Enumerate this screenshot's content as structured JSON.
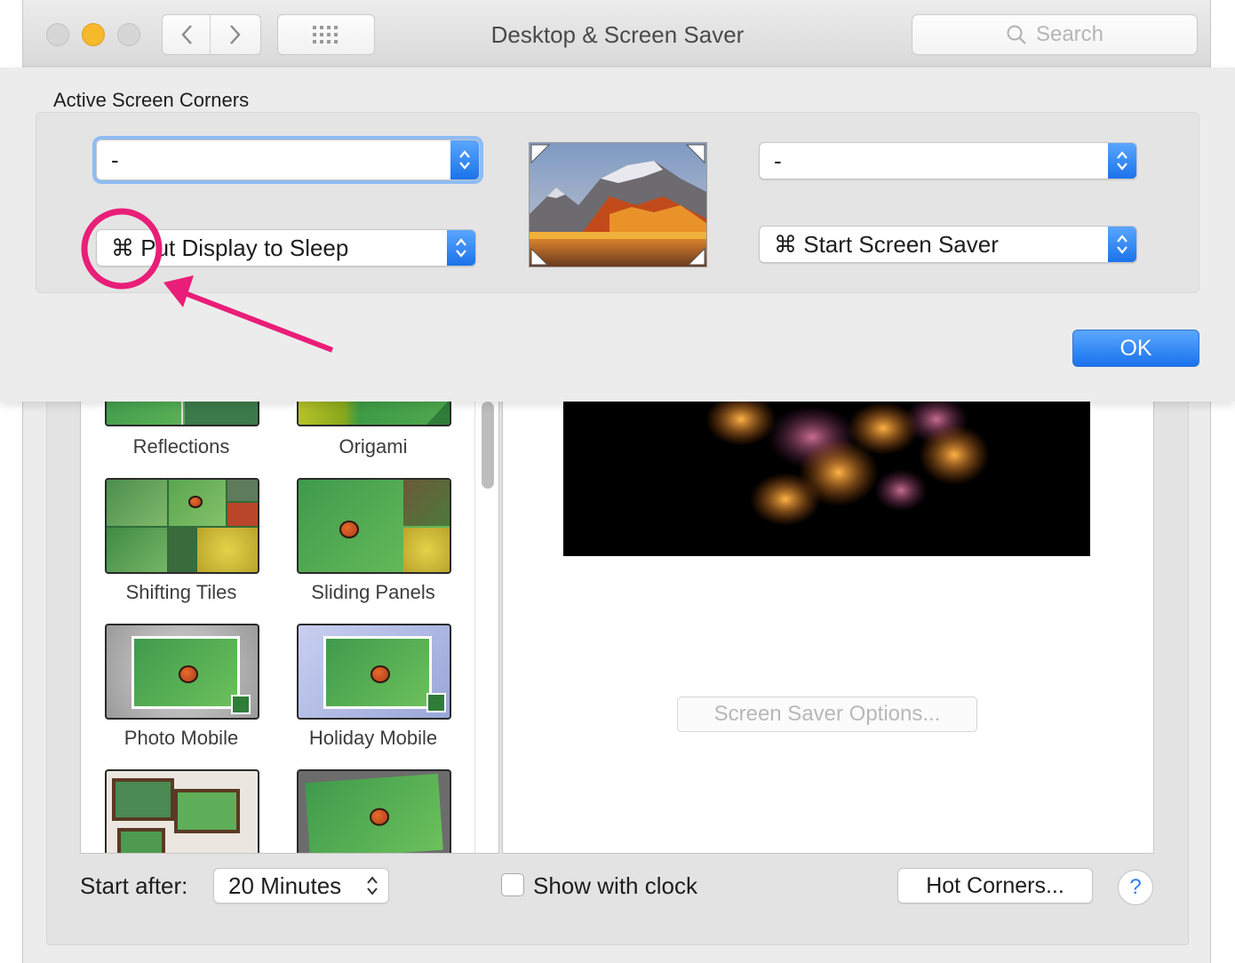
{
  "window": {
    "title": "Desktop & Screen Saver",
    "search_placeholder": "Search"
  },
  "sheet": {
    "title": "Active Screen Corners",
    "top_left_corner": "-",
    "top_right_corner": "-",
    "bottom_left_corner": "⌘ Put Display to Sleep",
    "bottom_right_corner": "⌘ Start Screen Saver",
    "ok_label": "OK"
  },
  "screen_savers": [
    {
      "label": "Reflections"
    },
    {
      "label": "Origami"
    },
    {
      "label": "Shifting Tiles"
    },
    {
      "label": "Sliding Panels"
    },
    {
      "label": "Photo Mobile"
    },
    {
      "label": "Holiday Mobile"
    }
  ],
  "preview": {
    "options_label": "Screen Saver Options..."
  },
  "bottom_bar": {
    "start_after_label": "Start after:",
    "start_after_value": "20 Minutes",
    "show_clock_label": "Show with clock",
    "show_clock_checked": false,
    "hot_corners_label": "Hot Corners...",
    "help_label": "?"
  },
  "colors": {
    "accent": "#1b73ea",
    "annotation": "#e91e78"
  }
}
